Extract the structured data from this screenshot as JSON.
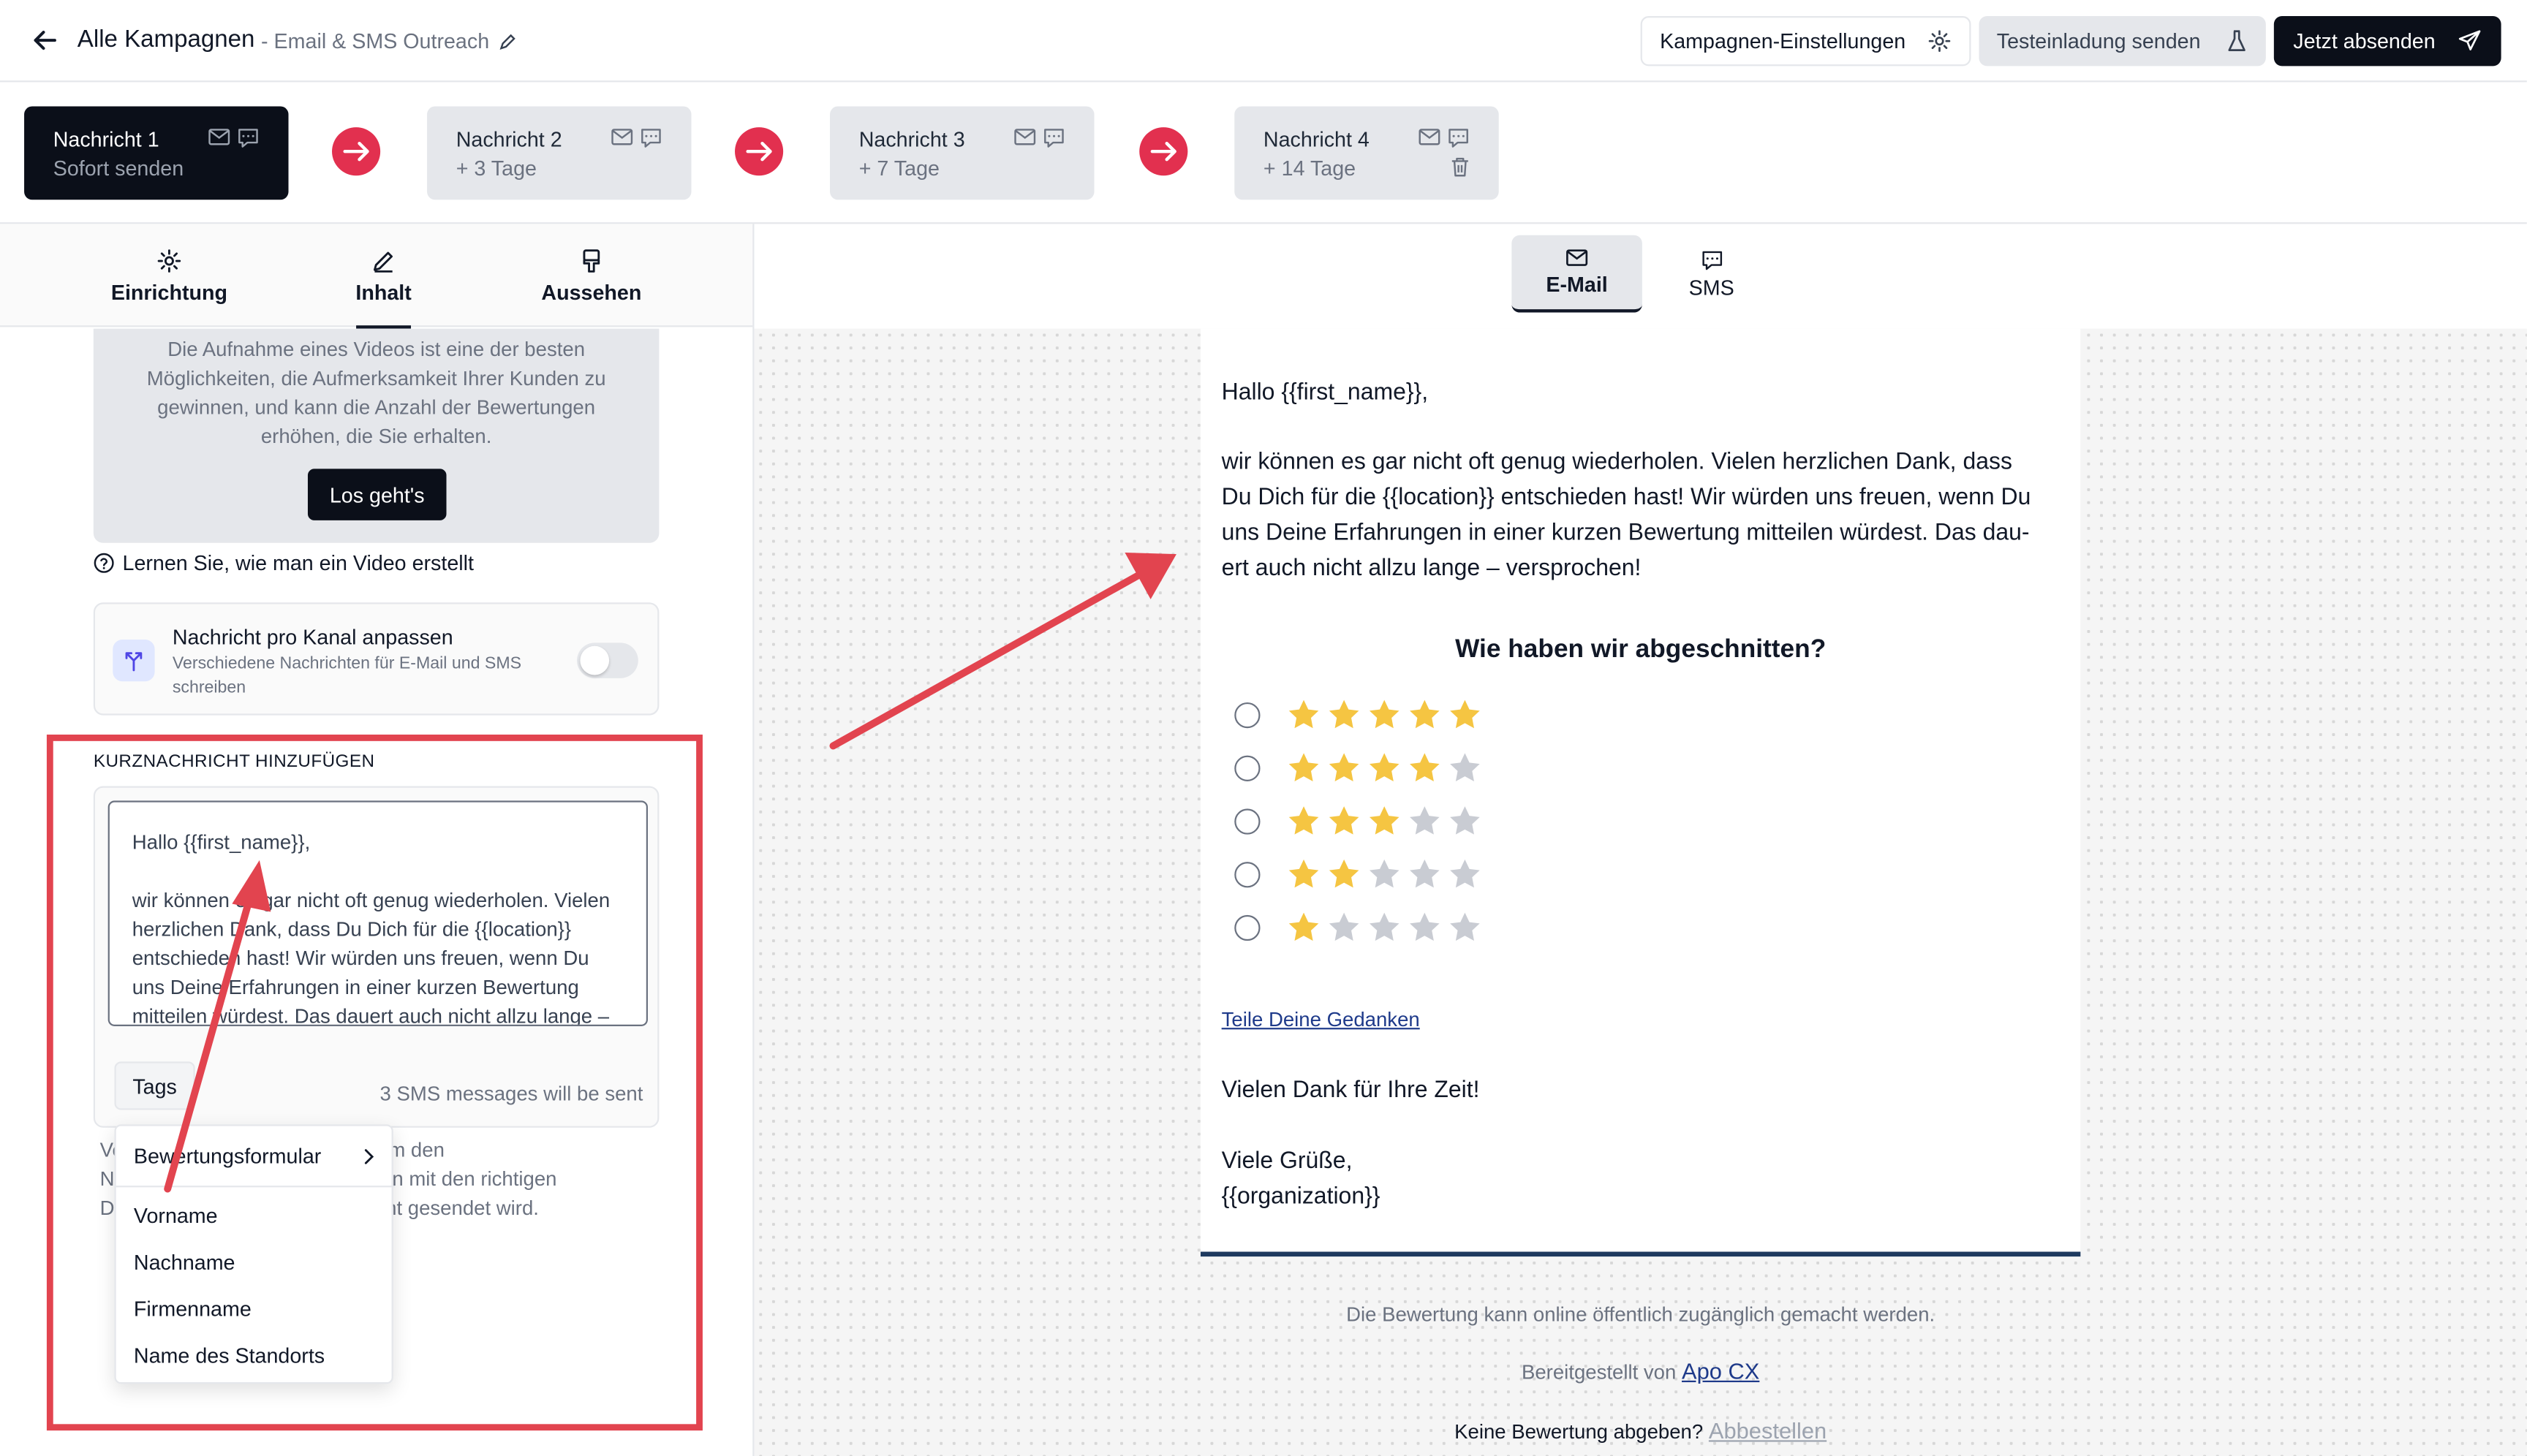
{
  "header": {
    "title": "Alle Kampagnen",
    "subtitle": "- Email & SMS Outreach",
    "settings_label": "Kampagnen-Einstellungen",
    "test_label": "Testeinladung senden",
    "send_label": "Jetzt absenden"
  },
  "messages": [
    {
      "name": "Nachricht 1",
      "timing": "Sofort senden"
    },
    {
      "name": "Nachricht 2",
      "timing": "+ 3 Tage"
    },
    {
      "name": "Nachricht 3",
      "timing": "+ 7 Tage"
    },
    {
      "name": "Nachricht 4",
      "timing": "+ 14 Tage"
    }
  ],
  "left_tabs": [
    "Einrichtung",
    "Inhalt",
    "Aussehen"
  ],
  "promo": {
    "text": "Die Aufnahme eines Videos ist eine der besten Möglichkeiten, die Aufmerksamkeit Ihrer Kunden zu gewinnen, und kann die Anzahl der Bewertungen erhöhen, die Sie erhalten.",
    "button": "Los geht's"
  },
  "learn_link": "Lernen Sie, wie man ein Video erstellt",
  "channel": {
    "title": "Nachricht pro Kanal anpassen",
    "description": "Verschiedene Nachrichten für E-Mail und SMS schreiben"
  },
  "sms": {
    "label": "KURZNACHRICHT HINZUFÜGEN",
    "body": "Hallo {{first_name}},\n\nwir können es gar nicht oft genug wiederholen. Vielen herzlichen Dank, dass Du Dich für die {{location}} entschieden hast! Wir würden uns freuen, wenn Du uns Deine Erfahrungen in einer kurzen Bewertung mitteilen würdest. Das dauert auch nicht allzu lange –",
    "tags_label": "Tags",
    "count_text": "3 SMS messages will be sent",
    "help_text": "Verwenden Sie die Tags oben, um den\nNamen einzufügen. Diese werden mit den richtigen\nDaten ersetzt, wenn die Nachricht gesendet wird."
  },
  "dropdown": {
    "header": "Bewertungsformular",
    "items": [
      "Vorname",
      "Nachname",
      "Firmenname",
      "Name des Standorts"
    ]
  },
  "right_tabs": [
    "E-Mail",
    "SMS"
  ],
  "email": {
    "greeting": "Hallo {{first_name}},",
    "body_lines": [
      "wir können es gar nicht oft genug wiederholen. Vielen herzlichen Dank, dass",
      "Du Dich für die {{location}} entschieden hast! Wir würden uns freuen, wenn Du",
      "uns Deine Erfahrungen in einer kurzen Bewertung mitteilen würdest. Das dau-",
      "ert auch nicht allzu lange – versprochen!"
    ],
    "question": "Wie haben wir abgeschnitten?",
    "ratings": [
      5,
      4,
      3,
      2,
      1
    ],
    "share_link": "Teile Deine Gedanken",
    "thanks": "Vielen Dank für Ihre Zeit!",
    "closing": "Viele Grüße,",
    "signature": "{{organization}}"
  },
  "footer": {
    "public_note": "Die Bewertung kann online öffentlich zugänglich gemacht werden.",
    "provided_by": "Bereitgestellt von",
    "provider": "Apo CX",
    "no_review": "Keine Bewertung abgeben?",
    "unsubscribe": "Abbestellen"
  },
  "colors": {
    "accent_red": "#e2304f",
    "star_on": "#f5c542",
    "star_off": "#c9ccd3",
    "dark": "#0b0f19"
  }
}
